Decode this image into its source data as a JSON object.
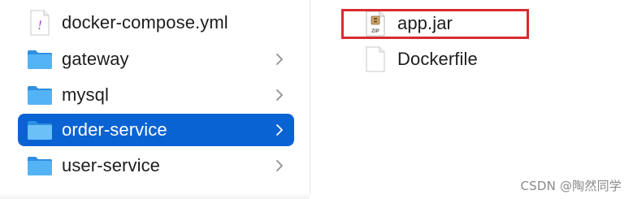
{
  "left_column": {
    "items": [
      {
        "label": "docker-compose.yml",
        "type": "file",
        "icon": "yaml-file-icon"
      },
      {
        "label": "gateway",
        "type": "folder",
        "icon": "folder-icon"
      },
      {
        "label": "mysql",
        "type": "folder",
        "icon": "folder-icon"
      },
      {
        "label": "order-service",
        "type": "folder",
        "icon": "folder-icon",
        "selected": true
      },
      {
        "label": "user-service",
        "type": "folder",
        "icon": "folder-icon"
      }
    ]
  },
  "right_column": {
    "items": [
      {
        "label": "app.jar",
        "type": "file",
        "icon": "zip-archive-icon",
        "highlighted": true
      },
      {
        "label": "Dockerfile",
        "type": "file",
        "icon": "document-icon"
      }
    ]
  },
  "watermark": {
    "text": "CSDN @陶然同学"
  },
  "colors": {
    "selection": "#0a63d3",
    "folder": "#3aa2f0",
    "highlight_border": "#d92b2b"
  }
}
